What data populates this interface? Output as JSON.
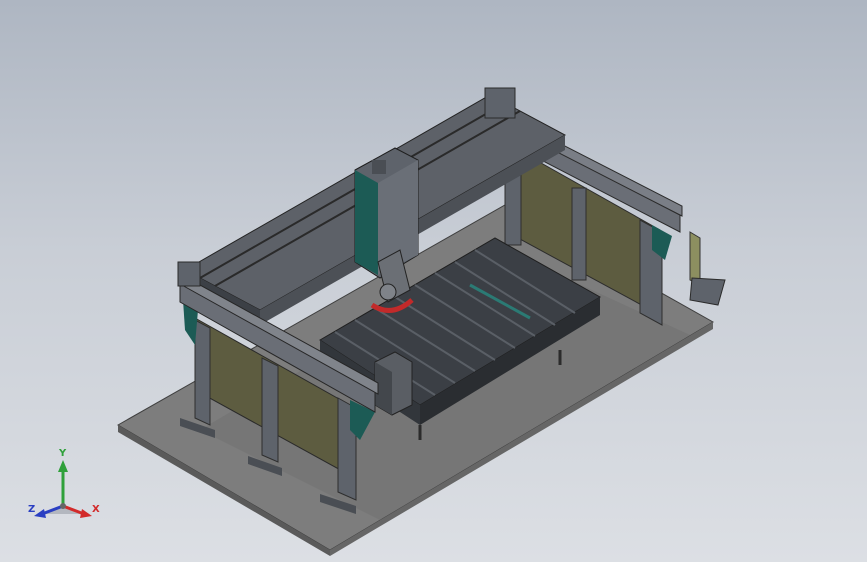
{
  "view": {
    "background_top": "#aeb6c2",
    "background_bottom": "#dcdfe4"
  },
  "model": {
    "colors": {
      "frame": "#5e636b",
      "panel": "#5c5b3f",
      "gantry_accent": "#1c5b55",
      "table": "#3b3f45",
      "base_plate": "#7b7b7b",
      "blade": "#c22a2a"
    }
  },
  "triad": {
    "x_label": "X",
    "y_label": "Y",
    "z_label": "Z",
    "x_color": "#d22a2a",
    "y_color": "#2fa03a",
    "z_color": "#2a3fc2"
  }
}
